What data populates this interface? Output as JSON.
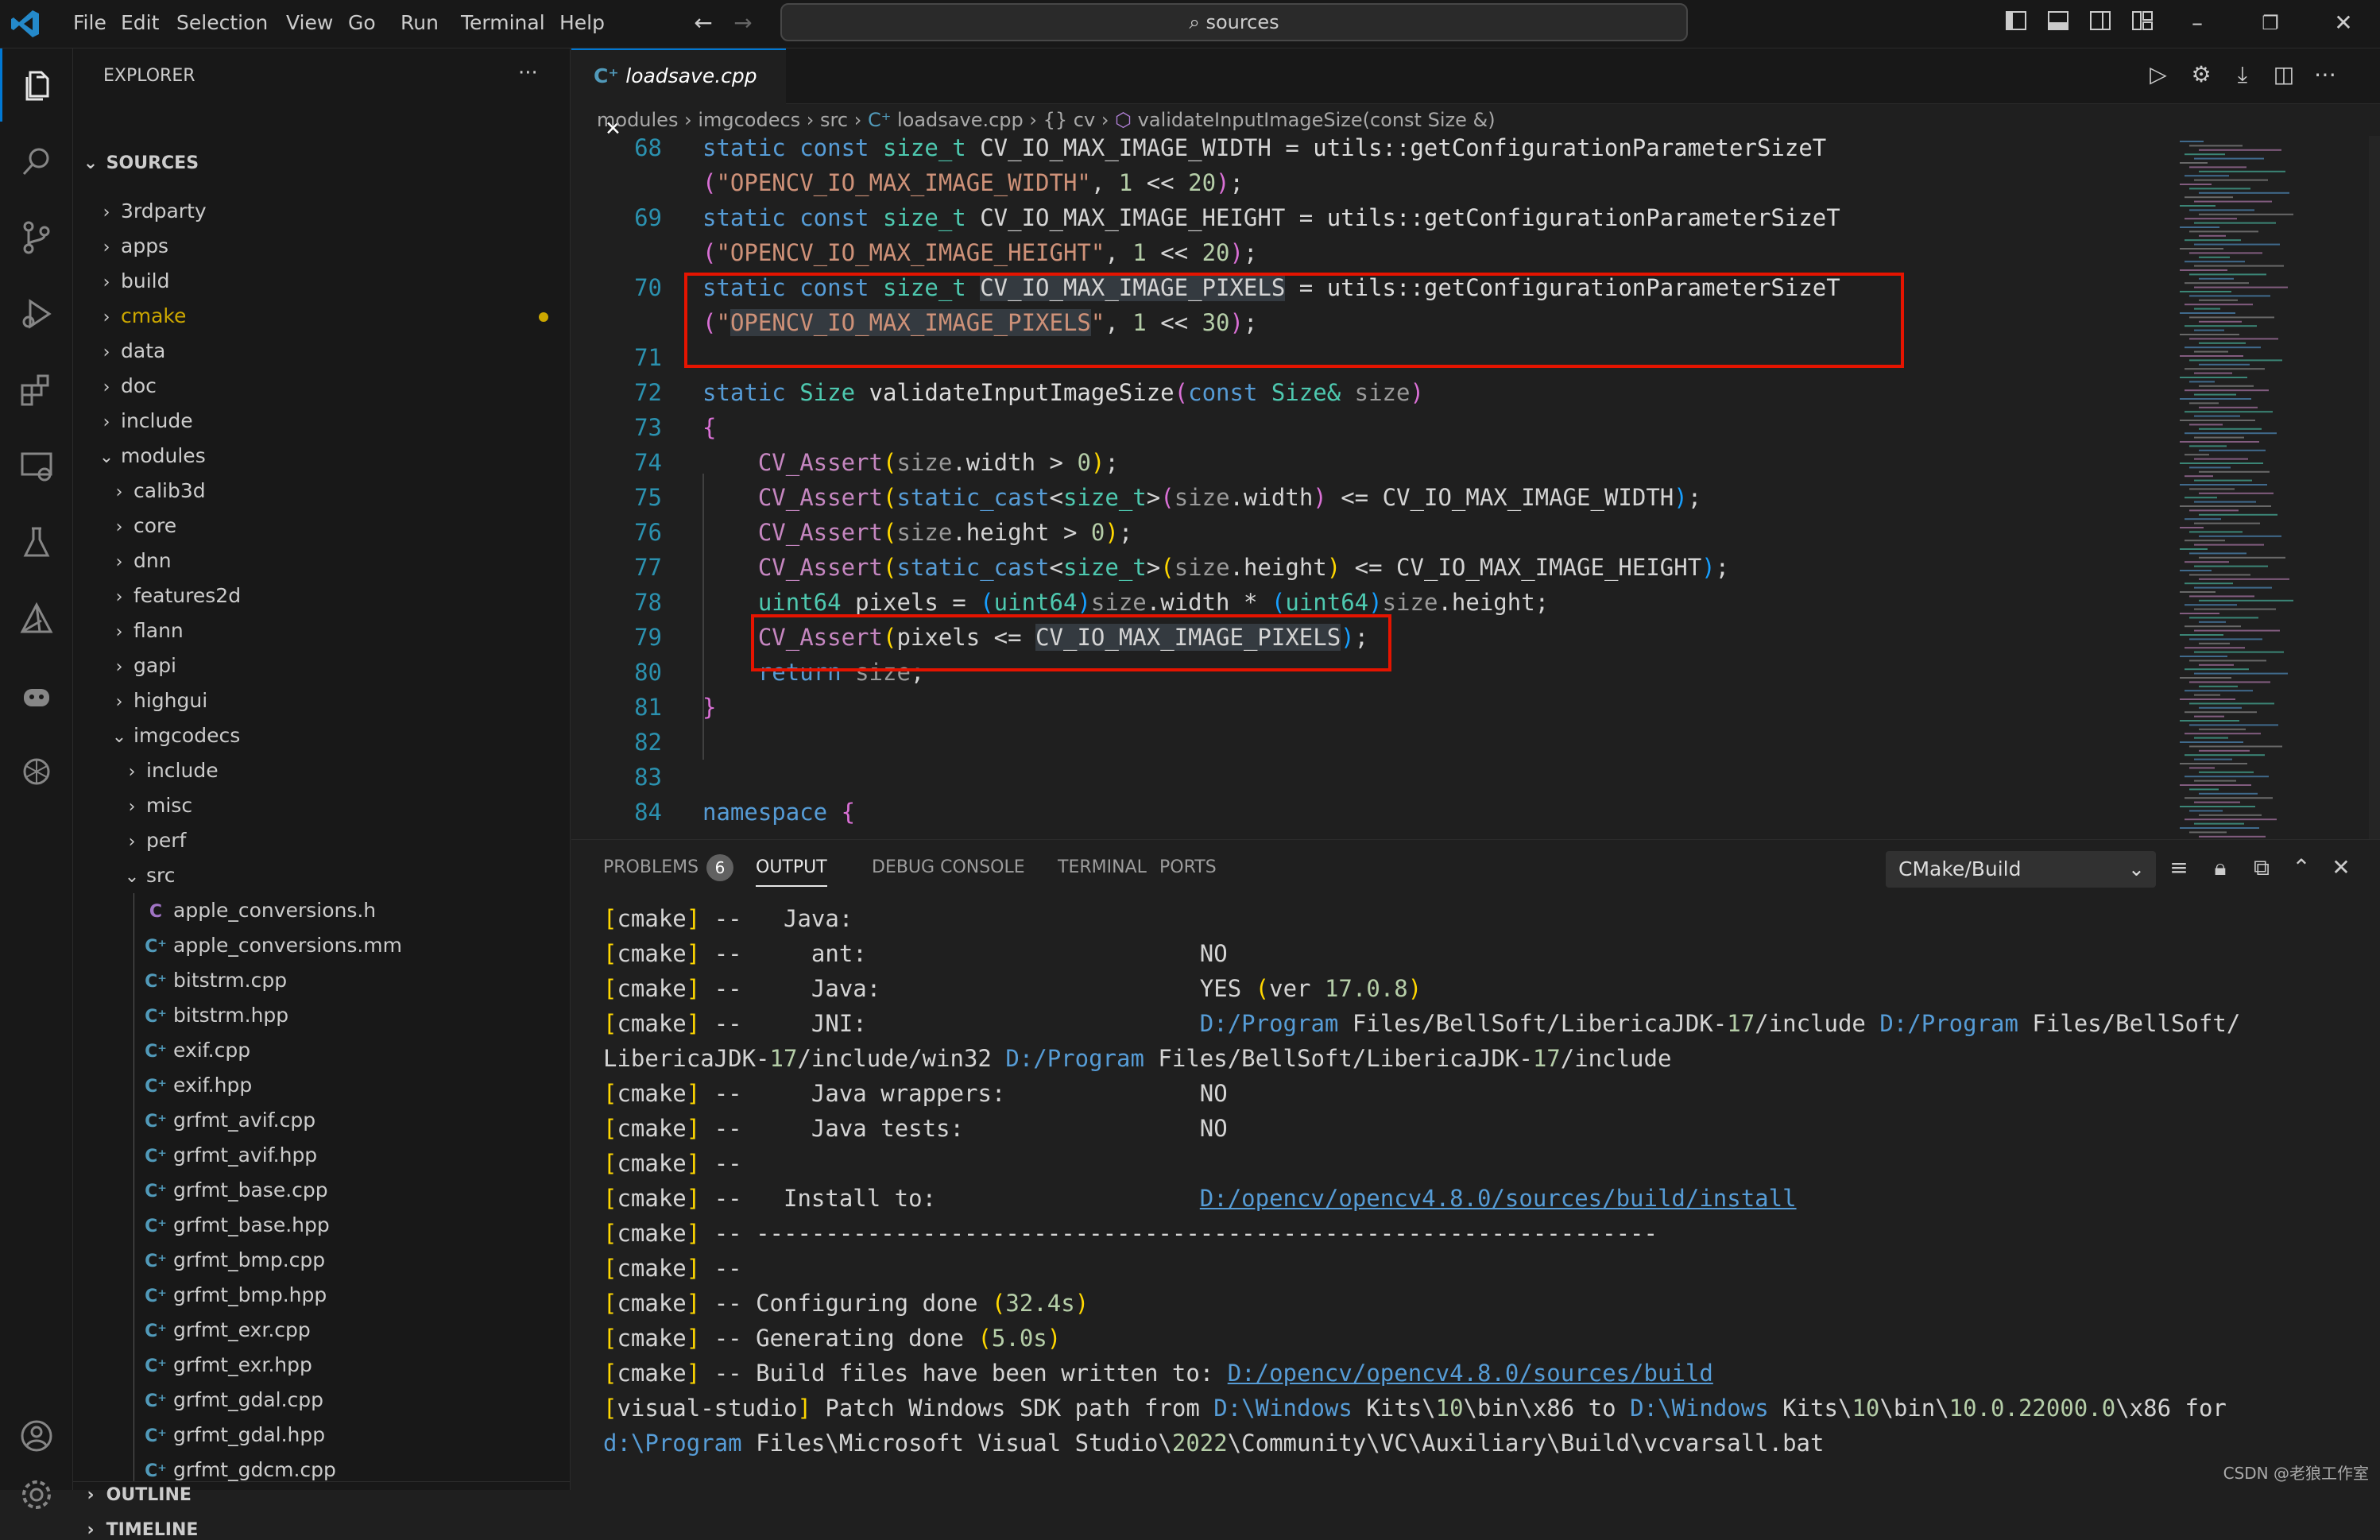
{
  "titlebar": {
    "menu": [
      "File",
      "Edit",
      "Selection",
      "View",
      "Go",
      "Run",
      "Terminal",
      "Help"
    ],
    "search": "sources"
  },
  "sidebar": {
    "title": "EXPLORER",
    "more": "···",
    "section": "SOURCES",
    "items": [
      {
        "label": "3rdparty",
        "depth": 0,
        "kind": "folder",
        "open": false
      },
      {
        "label": "apps",
        "depth": 0,
        "kind": "folder",
        "open": false
      },
      {
        "label": "build",
        "depth": 0,
        "kind": "folder",
        "open": false
      },
      {
        "label": "cmake",
        "depth": 0,
        "kind": "folder",
        "open": false,
        "modified": true
      },
      {
        "label": "data",
        "depth": 0,
        "kind": "folder",
        "open": false
      },
      {
        "label": "doc",
        "depth": 0,
        "kind": "folder",
        "open": false
      },
      {
        "label": "include",
        "depth": 0,
        "kind": "folder",
        "open": false
      },
      {
        "label": "modules",
        "depth": 0,
        "kind": "folder",
        "open": true
      },
      {
        "label": "calib3d",
        "depth": 1,
        "kind": "folder",
        "open": false
      },
      {
        "label": "core",
        "depth": 1,
        "kind": "folder",
        "open": false
      },
      {
        "label": "dnn",
        "depth": 1,
        "kind": "folder",
        "open": false
      },
      {
        "label": "features2d",
        "depth": 1,
        "kind": "folder",
        "open": false
      },
      {
        "label": "flann",
        "depth": 1,
        "kind": "folder",
        "open": false
      },
      {
        "label": "gapi",
        "depth": 1,
        "kind": "folder",
        "open": false
      },
      {
        "label": "highgui",
        "depth": 1,
        "kind": "folder",
        "open": false
      },
      {
        "label": "imgcodecs",
        "depth": 1,
        "kind": "folder",
        "open": true
      },
      {
        "label": "include",
        "depth": 2,
        "kind": "folder",
        "open": false
      },
      {
        "label": "misc",
        "depth": 2,
        "kind": "folder",
        "open": false
      },
      {
        "label": "perf",
        "depth": 2,
        "kind": "folder",
        "open": false
      },
      {
        "label": "src",
        "depth": 2,
        "kind": "folder",
        "open": true
      },
      {
        "label": "apple_conversions.h",
        "depth": 3,
        "kind": "c"
      },
      {
        "label": "apple_conversions.mm",
        "depth": 3,
        "kind": "cpp"
      },
      {
        "label": "bitstrm.cpp",
        "depth": 3,
        "kind": "cpp"
      },
      {
        "label": "bitstrm.hpp",
        "depth": 3,
        "kind": "cpp"
      },
      {
        "label": "exif.cpp",
        "depth": 3,
        "kind": "cpp"
      },
      {
        "label": "exif.hpp",
        "depth": 3,
        "kind": "cpp"
      },
      {
        "label": "grfmt_avif.cpp",
        "depth": 3,
        "kind": "cpp"
      },
      {
        "label": "grfmt_avif.hpp",
        "depth": 3,
        "kind": "cpp"
      },
      {
        "label": "grfmt_base.cpp",
        "depth": 3,
        "kind": "cpp"
      },
      {
        "label": "grfmt_base.hpp",
        "depth": 3,
        "kind": "cpp"
      },
      {
        "label": "grfmt_bmp.cpp",
        "depth": 3,
        "kind": "cpp"
      },
      {
        "label": "grfmt_bmp.hpp",
        "depth": 3,
        "kind": "cpp"
      },
      {
        "label": "grfmt_exr.cpp",
        "depth": 3,
        "kind": "cpp"
      },
      {
        "label": "grfmt_exr.hpp",
        "depth": 3,
        "kind": "cpp"
      },
      {
        "label": "grfmt_gdal.cpp",
        "depth": 3,
        "kind": "cpp"
      },
      {
        "label": "grfmt_gdal.hpp",
        "depth": 3,
        "kind": "cpp"
      },
      {
        "label": "grfmt_gdcm.cpp",
        "depth": 3,
        "kind": "cpp"
      }
    ],
    "outline": "OUTLINE",
    "timeline": "TIMELINE"
  },
  "editor": {
    "tab": "loadsave.cpp",
    "breadcrumb": [
      "modules",
      "imgcodecs",
      "src",
      "loadsave.cpp",
      "{} cv",
      "validateInputImageSize(const Size &)"
    ],
    "lines": [
      {
        "n": "68",
        "t": [
          [
            "static ",
            "kw"
          ],
          [
            "const ",
            "kw"
          ],
          [
            "size_t ",
            "ty"
          ],
          [
            "CV_IO_MAX_IMAGE_WIDTH ",
            "id"
          ],
          [
            "= ",
            "pl"
          ],
          [
            "utils::getConfigurationParameterSizeT",
            "fn"
          ]
        ]
      },
      {
        "n": "",
        "t": [
          [
            "(",
            "b1"
          ],
          [
            "\"OPENCV_IO_MAX_IMAGE_WIDTH\"",
            "st"
          ],
          [
            ", ",
            "pl"
          ],
          [
            "1 ",
            "nu"
          ],
          [
            "<< ",
            "pl"
          ],
          [
            "20",
            "nu"
          ],
          [
            ")",
            "b1"
          ],
          [
            ";",
            "pl"
          ]
        ]
      },
      {
        "n": "69",
        "t": [
          [
            "static ",
            "kw"
          ],
          [
            "const ",
            "kw"
          ],
          [
            "size_t ",
            "ty"
          ],
          [
            "CV_IO_MAX_IMAGE_HEIGHT ",
            "id"
          ],
          [
            "= ",
            "pl"
          ],
          [
            "utils::getConfigurationParameterSizeT",
            "fn"
          ]
        ]
      },
      {
        "n": "",
        "t": [
          [
            "(",
            "b1"
          ],
          [
            "\"OPENCV_IO_MAX_IMAGE_HEIGHT\"",
            "st"
          ],
          [
            ", ",
            "pl"
          ],
          [
            "1 ",
            "nu"
          ],
          [
            "<< ",
            "pl"
          ],
          [
            "20",
            "nu"
          ],
          [
            ")",
            "b1"
          ],
          [
            ";",
            "pl"
          ]
        ]
      },
      {
        "n": "70",
        "t": [
          [
            "static ",
            "kw"
          ],
          [
            "const ",
            "kw"
          ],
          [
            "size_t ",
            "ty"
          ],
          [
            "CV_IO_MAX_IMAGE_PIXELS",
            "id hl"
          ],
          [
            " = ",
            "pl"
          ],
          [
            "utils::getConfigurationParameterSizeT",
            "fn"
          ]
        ]
      },
      {
        "n": "",
        "t": [
          [
            "(",
            "b1"
          ],
          [
            "\"",
            "st"
          ],
          [
            "OPENCV_IO_MAX_IMAGE_PIXELS",
            "st hl"
          ],
          [
            "\"",
            "st"
          ],
          [
            ", ",
            "pl"
          ],
          [
            "1 ",
            "nu"
          ],
          [
            "<< ",
            "pl"
          ],
          [
            "30",
            "nu"
          ],
          [
            ")",
            "b1"
          ],
          [
            ";",
            "pl"
          ]
        ]
      },
      {
        "n": "71",
        "t": []
      },
      {
        "n": "72",
        "t": [
          [
            "static ",
            "kw"
          ],
          [
            "Size ",
            "ty"
          ],
          [
            "validateInputImageSize",
            "fn"
          ],
          [
            "(",
            "b1"
          ],
          [
            "const ",
            "kw"
          ],
          [
            "Size& ",
            "ty"
          ],
          [
            "size",
            "dim"
          ],
          [
            ")",
            "b1"
          ]
        ]
      },
      {
        "n": "73",
        "t": [
          [
            "{",
            "b1"
          ]
        ]
      },
      {
        "n": "74",
        "t": [
          [
            "    CV_Assert",
            "ma"
          ],
          [
            "(",
            "b2"
          ],
          [
            "size",
            "dim"
          ],
          [
            ".width > ",
            "pl"
          ],
          [
            "0",
            "nu"
          ],
          [
            ")",
            "b2"
          ],
          [
            ";",
            "pl"
          ]
        ]
      },
      {
        "n": "75",
        "t": [
          [
            "    CV_Assert",
            "ma"
          ],
          [
            "(",
            "b2"
          ],
          [
            "static_cast",
            "kw"
          ],
          [
            "<",
            "pl"
          ],
          [
            "size_t",
            "ty"
          ],
          [
            ">",
            "pl"
          ],
          [
            "(",
            "b1"
          ],
          [
            "size",
            "dim"
          ],
          [
            ".width",
            "pl"
          ],
          [
            ")",
            "b1"
          ],
          [
            " <= CV_IO_MAX_IMAGE_WIDTH",
            "pl"
          ],
          [
            ")",
            "b3"
          ],
          [
            ";",
            "pl"
          ]
        ]
      },
      {
        "n": "76",
        "t": [
          [
            "    CV_Assert",
            "ma"
          ],
          [
            "(",
            "b2"
          ],
          [
            "size",
            "dim"
          ],
          [
            ".height > ",
            "pl"
          ],
          [
            "0",
            "nu"
          ],
          [
            ")",
            "b2"
          ],
          [
            ";",
            "pl"
          ]
        ]
      },
      {
        "n": "77",
        "t": [
          [
            "    CV_Assert",
            "ma"
          ],
          [
            "(",
            "b2"
          ],
          [
            "static_cast",
            "kw"
          ],
          [
            "<",
            "pl"
          ],
          [
            "size_t",
            "ty"
          ],
          [
            ">",
            "pl"
          ],
          [
            "(",
            "b2"
          ],
          [
            "size",
            "dim"
          ],
          [
            ".height",
            "pl"
          ],
          [
            ")",
            "b2"
          ],
          [
            " <= CV_IO_MAX_IMAGE_HEIGHT",
            "pl"
          ],
          [
            ")",
            "b3"
          ],
          [
            ";",
            "pl"
          ]
        ]
      },
      {
        "n": "78",
        "t": [
          [
            "    uint64 ",
            "ty"
          ],
          [
            "pixels = ",
            "pl"
          ],
          [
            "(",
            "b3"
          ],
          [
            "uint64",
            "ty"
          ],
          [
            ")",
            "b3"
          ],
          [
            "size",
            "dim"
          ],
          [
            ".width * ",
            "pl"
          ],
          [
            "(",
            "b3"
          ],
          [
            "uint64",
            "ty"
          ],
          [
            ")",
            "b3"
          ],
          [
            "size",
            "dim"
          ],
          [
            ".height;",
            "pl"
          ]
        ]
      },
      {
        "n": "79",
        "t": [
          [
            "    CV_Assert",
            "ma"
          ],
          [
            "(",
            "b2"
          ],
          [
            "pixels <= ",
            "pl"
          ],
          [
            "CV_IO_MAX_IMAGE_PIXELS",
            "pl hl"
          ],
          [
            ")",
            "b3"
          ],
          [
            ";",
            "pl"
          ]
        ]
      },
      {
        "n": "80",
        "t": [
          [
            "    return ",
            "kw"
          ],
          [
            "size",
            "dim"
          ],
          [
            ";",
            "pl"
          ]
        ]
      },
      {
        "n": "81",
        "t": [
          [
            "}",
            "b1"
          ]
        ]
      },
      {
        "n": "82",
        "t": []
      },
      {
        "n": "83",
        "t": []
      },
      {
        "n": "84",
        "t": [
          [
            "namespace ",
            "kw"
          ],
          [
            "{",
            "b1"
          ]
        ]
      }
    ]
  },
  "panel": {
    "tabs": [
      "PROBLEMS",
      "OUTPUT",
      "DEBUG CONSOLE",
      "TERMINAL",
      "PORTS"
    ],
    "problems_count": "6",
    "active_tab": "OUTPUT",
    "channel": "CMake/Build",
    "lines": [
      [
        [
          "[",
          "ob"
        ],
        [
          "cmake",
          "ot"
        ],
        [
          "]",
          "ob"
        ],
        [
          " --   Java:",
          "ot"
        ]
      ],
      [
        [
          "[",
          "ob"
        ],
        [
          "cmake",
          "ot"
        ],
        [
          "]",
          "ob"
        ],
        [
          " --     ant:                        NO",
          "ot"
        ]
      ],
      [
        [
          "[",
          "ob"
        ],
        [
          "cmake",
          "ot"
        ],
        [
          "]",
          "ob"
        ],
        [
          " --     Java:                       YES ",
          "ot"
        ],
        [
          "(",
          "ob"
        ],
        [
          "ver ",
          "ot"
        ],
        [
          "17.0.8",
          "on"
        ],
        [
          ")",
          "ob"
        ]
      ],
      [
        [
          "[",
          "ob"
        ],
        [
          "cmake",
          "ot"
        ],
        [
          "]",
          "ob"
        ],
        [
          " --     JNI:                        ",
          "ot"
        ],
        [
          "D:/Program",
          "op"
        ],
        [
          " Files/BellSoft/LibericaJDK-",
          "ot"
        ],
        [
          "17",
          "on"
        ],
        [
          "/include ",
          "ot"
        ],
        [
          "D:/Program",
          "op"
        ],
        [
          " Files/BellSoft/",
          "ot"
        ]
      ],
      [
        [
          "LibericaJDK-",
          "ot"
        ],
        [
          "17",
          "on"
        ],
        [
          "/include/win32 ",
          "ot"
        ],
        [
          "D:/Program",
          "op"
        ],
        [
          " Files/BellSoft/LibericaJDK-",
          "ot"
        ],
        [
          "17",
          "on"
        ],
        [
          "/include",
          "ot"
        ]
      ],
      [
        [
          "[",
          "ob"
        ],
        [
          "cmake",
          "ot"
        ],
        [
          "]",
          "ob"
        ],
        [
          " --     Java wrappers:              NO",
          "ot"
        ]
      ],
      [
        [
          "[",
          "ob"
        ],
        [
          "cmake",
          "ot"
        ],
        [
          "]",
          "ob"
        ],
        [
          " --     Java tests:                 NO",
          "ot"
        ]
      ],
      [
        [
          "[",
          "ob"
        ],
        [
          "cmake",
          "ot"
        ],
        [
          "]",
          "ob"
        ],
        [
          " --",
          "ot"
        ]
      ],
      [
        [
          "[",
          "ob"
        ],
        [
          "cmake",
          "ot"
        ],
        [
          "]",
          "ob"
        ],
        [
          " --   Install to:                   ",
          "ot"
        ],
        [
          "D:/opencv/opencv4.8.0/sources/build/install",
          "ou"
        ]
      ],
      [
        [
          "[",
          "ob"
        ],
        [
          "cmake",
          "ot"
        ],
        [
          "]",
          "ob"
        ],
        [
          " -- -----------------------------------------------------------------",
          "ot"
        ]
      ],
      [
        [
          "[",
          "ob"
        ],
        [
          "cmake",
          "ot"
        ],
        [
          "]",
          "ob"
        ],
        [
          " --",
          "ot"
        ]
      ],
      [
        [
          "[",
          "ob"
        ],
        [
          "cmake",
          "ot"
        ],
        [
          "]",
          "ob"
        ],
        [
          " -- Configuring done ",
          "ot"
        ],
        [
          "(",
          "ob"
        ],
        [
          "32.4s",
          "on"
        ],
        [
          ")",
          "ob"
        ]
      ],
      [
        [
          "[",
          "ob"
        ],
        [
          "cmake",
          "ot"
        ],
        [
          "]",
          "ob"
        ],
        [
          " -- Generating done ",
          "ot"
        ],
        [
          "(",
          "ob"
        ],
        [
          "5.0s",
          "on"
        ],
        [
          ")",
          "ob"
        ]
      ],
      [
        [
          "[",
          "ob"
        ],
        [
          "cmake",
          "ot"
        ],
        [
          "]",
          "ob"
        ],
        [
          " -- Build files have been written to: ",
          "ot"
        ],
        [
          "D:/opencv/opencv4.8.0/sources/build",
          "ou"
        ]
      ],
      [
        [
          "[",
          "ob"
        ],
        [
          "visual-studio",
          "ot"
        ],
        [
          "]",
          "ob"
        ],
        [
          " Patch Windows SDK path from ",
          "ot"
        ],
        [
          "D:\\Windows",
          "op"
        ],
        [
          " Kits\\",
          "ot"
        ],
        [
          "10",
          "on"
        ],
        [
          "\\bin\\x86 to ",
          "ot"
        ],
        [
          "D:\\Windows",
          "op"
        ],
        [
          " Kits\\",
          "ot"
        ],
        [
          "10",
          "on"
        ],
        [
          "\\bin\\",
          "ot"
        ],
        [
          "10.0.22000.0",
          "on"
        ],
        [
          "\\x86 for",
          "ot"
        ]
      ],
      [
        [
          "d:\\Program",
          "op"
        ],
        [
          " Files\\Microsoft Visual Studio\\",
          "ot"
        ],
        [
          "2022",
          "on"
        ],
        [
          "\\Community\\VC\\Auxiliary\\Build\\vcvarsall.bat",
          "ot"
        ]
      ]
    ]
  },
  "watermark": "CSDN @老狼工作室",
  "colors": {
    "accent": "#0078d4",
    "highlight_box": "#e51400",
    "cmake_modified": "#cca700"
  }
}
